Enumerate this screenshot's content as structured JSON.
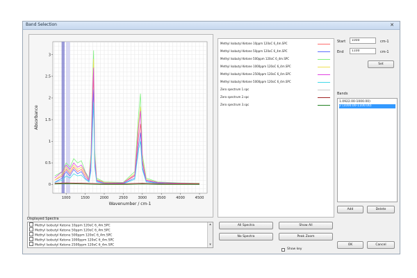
{
  "window": {
    "title": "Band Selection",
    "close_glyph": "✕"
  },
  "chart_data": {
    "type": "line",
    "xlabel": "Wavenumber / cm-1",
    "ylabel": "Absorbance",
    "xticks": [
      "1000",
      "1500",
      "2000",
      "2500",
      "3000",
      "3500",
      "4000",
      "4500"
    ],
    "yticks": [
      "0",
      "0.5",
      "1",
      "1.5",
      "2",
      "2.5",
      "3"
    ],
    "xlim": [
      650,
      4700
    ],
    "ylim": [
      -0.2,
      3.3
    ],
    "grid": true,
    "series": [
      {
        "color": "#ff6b6b",
        "x": [
          700,
          900,
          1000,
          1100,
          1200,
          1300,
          1400,
          1500,
          1600,
          1650,
          1700,
          1720,
          1750,
          1800,
          2000,
          2500,
          2800,
          2900,
          2950,
          3000,
          3100,
          3400,
          4000,
          4500
        ],
        "y": [
          0.1,
          0.2,
          0.35,
          0.25,
          0.4,
          0.3,
          0.35,
          0.2,
          0.1,
          0.5,
          2.1,
          2.5,
          0.6,
          0.1,
          0.05,
          0.04,
          0.2,
          1.1,
          1.4,
          0.5,
          0.1,
          0.05,
          0.03,
          0.02
        ]
      },
      {
        "color": "#5c6cff",
        "x": [
          700,
          900,
          1000,
          1100,
          1200,
          1300,
          1400,
          1500,
          1600,
          1650,
          1700,
          1720,
          1750,
          1800,
          2000,
          2500,
          2800,
          2900,
          2950,
          3000,
          3100,
          3400,
          4000,
          4500
        ],
        "y": [
          0.05,
          0.15,
          0.3,
          0.2,
          0.35,
          0.25,
          0.3,
          0.15,
          0.08,
          0.4,
          1.8,
          2.2,
          0.5,
          0.08,
          0.03,
          0.03,
          0.15,
          0.9,
          1.2,
          0.4,
          0.08,
          0.04,
          0.02,
          0.01
        ]
      },
      {
        "color": "#7cf07c",
        "x": [
          700,
          900,
          1000,
          1100,
          1200,
          1300,
          1400,
          1500,
          1600,
          1650,
          1700,
          1720,
          1750,
          1800,
          2000,
          2500,
          2800,
          2900,
          2950,
          3000,
          3100,
          3400,
          4000,
          4500
        ],
        "y": [
          0.2,
          0.3,
          0.5,
          0.4,
          0.6,
          0.5,
          0.55,
          0.3,
          0.15,
          0.7,
          2.6,
          3.1,
          0.8,
          0.15,
          0.06,
          0.05,
          0.3,
          1.6,
          2.1,
          0.7,
          0.15,
          0.06,
          0.04,
          0.03
        ]
      },
      {
        "color": "#f0e050",
        "x": [
          700,
          900,
          1000,
          1100,
          1200,
          1300,
          1400,
          1500,
          1600,
          1650,
          1700,
          1720,
          1750,
          1800,
          2000,
          2500,
          2800,
          2900,
          2950,
          3000,
          3100,
          3400,
          4000,
          4500
        ],
        "y": [
          0.1,
          0.25,
          0.4,
          0.3,
          0.45,
          0.35,
          0.4,
          0.25,
          0.12,
          0.6,
          2.4,
          2.9,
          0.7,
          0.12,
          0.05,
          0.04,
          0.25,
          1.4,
          1.8,
          0.6,
          0.12,
          0.05,
          0.03,
          0.02
        ]
      },
      {
        "color": "#e040e0",
        "x": [
          700,
          900,
          1000,
          1100,
          1200,
          1300,
          1400,
          1500,
          1600,
          1650,
          1700,
          1720,
          1750,
          1800,
          2000,
          2500,
          2800,
          2900,
          2950,
          3000,
          3100,
          3400,
          4000,
          4500
        ],
        "y": [
          0.15,
          0.3,
          0.45,
          0.35,
          0.5,
          0.4,
          0.45,
          0.28,
          0.1,
          0.55,
          2.3,
          2.7,
          0.65,
          0.1,
          0.04,
          0.04,
          0.22,
          1.3,
          1.7,
          0.55,
          0.1,
          0.05,
          0.03,
          0.02
        ]
      },
      {
        "color": "#40d8e8",
        "x": [
          700,
          900,
          1000,
          1100,
          1200,
          1300,
          1400,
          1500,
          1600,
          1650,
          1700,
          1720,
          1750,
          1800,
          2000,
          2500,
          2800,
          2900,
          2950,
          3000,
          3100,
          3400,
          4000,
          4500
        ],
        "y": [
          0.05,
          0.1,
          0.2,
          0.15,
          0.25,
          0.2,
          0.22,
          0.12,
          0.06,
          0.3,
          1.5,
          1.9,
          0.4,
          0.06,
          0.03,
          0.02,
          0.12,
          0.8,
          1.0,
          0.35,
          0.06,
          0.03,
          0.02,
          0.01
        ]
      },
      {
        "color": "#c8c8c8",
        "x": [
          700,
          1000,
          1500,
          2000,
          2500,
          3000,
          3500,
          4000,
          4500
        ],
        "y": [
          0.02,
          0.03,
          0.02,
          0.01,
          0.01,
          0.02,
          0.01,
          0.01,
          0.01
        ]
      },
      {
        "color": "#a02020",
        "x": [
          700,
          1000,
          1500,
          2000,
          2500,
          3000,
          3500,
          4000,
          4500
        ],
        "y": [
          0.03,
          0.04,
          0.03,
          0.02,
          0.02,
          0.03,
          0.02,
          0.02,
          0.02
        ]
      },
      {
        "color": "#208020",
        "x": [
          700,
          1000,
          1500,
          2000,
          2500,
          3000,
          3500,
          4000,
          4500
        ],
        "y": [
          0.01,
          0.02,
          0.01,
          0.0,
          0.0,
          0.01,
          0.0,
          0.0,
          0.0
        ]
      }
    ],
    "band_markers": [
      {
        "x": [
          880,
          960
        ],
        "color": "#7a7acc"
      },
      {
        "x": [
          1000,
          1100
        ],
        "color": "#c8c8f0"
      }
    ]
  },
  "legend": [
    {
      "label": "Methyl Isobutyl Ketone 10ppm 120oC 6_4m.SPC",
      "color": "#ff6b6b"
    },
    {
      "label": "Methyl Isobutyl Ketone 50ppm 120oC 6_4m.SPC",
      "color": "#5c6cff"
    },
    {
      "label": "Methyl Isobutyl Ketone 500ppm 120oC 6_4m.SPC",
      "color": "#7cf07c"
    },
    {
      "label": "Methyl Isobutyl Ketone 1000ppm 120oC 6_4m.SPC",
      "color": "#f0e050"
    },
    {
      "label": "Methyl Isobutyl Ketone 2500ppm 120oC 6_4m.SPC",
      "color": "#e040e0"
    },
    {
      "label": "Methyl Isobutyl Ketone 5000ppm 120oC 6_4m.SPC",
      "color": "#40d8e8"
    },
    {
      "label": "Zero spectrum 1.spc",
      "color": "#c8c8c8"
    },
    {
      "label": "Zero spectrum 2.spc",
      "color": "#a02020"
    },
    {
      "label": "Zero spectrum 3.spc",
      "color": "#208020"
    }
  ],
  "range": {
    "start_label": "Start",
    "start_value": "1000",
    "start_unit": "cm-1",
    "end_label": "End",
    "end_value": "1100",
    "end_unit": "cm-1",
    "set_label": "Set"
  },
  "bands": {
    "label": "Bands",
    "items": [
      {
        "text": "1.0922.00-1000.00)",
        "selected": false
      },
      {
        "text": "2 (1000.00-1100.00)",
        "selected": true
      }
    ],
    "add_label": "Add",
    "delete_label": "Delete"
  },
  "displayed": {
    "label": "Displayed Spectra",
    "items": [
      "Methyl Isobutyl Ketone 10ppm 120oC 6_4m.SPC",
      "Methyl Isobutyl Ketone 50ppm 120oC 6_4m.SPC",
      "Methyl Isobutyl Ketone 500ppm 120oC 6_4m.SPC",
      "Methyl Isobutyl Ketone 1000ppm 120oC 6_4m.SPC",
      "Methyl Isobutyl Ketone 2500ppm 120oC 6_4m.SPC"
    ]
  },
  "actions": {
    "all_spectra": "All Spectra",
    "no_spectra": "No Spectra",
    "show_all": "Show All",
    "peak_zoom": "Peak Zoom",
    "show_key": "Show key",
    "ok": "OK",
    "cancel": "Cancel"
  }
}
